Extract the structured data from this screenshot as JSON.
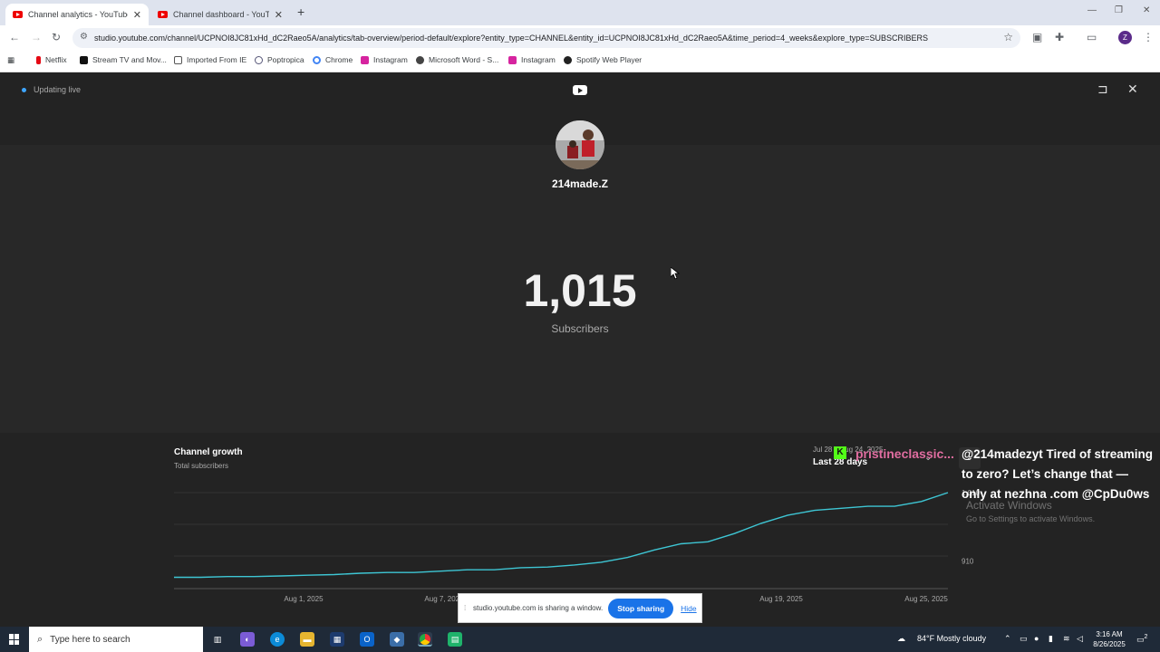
{
  "browser": {
    "tabs": [
      {
        "title": "Channel analytics - YouTube St",
        "active": true
      },
      {
        "title": "Channel dashboard - YouTube",
        "active": false
      }
    ],
    "new_tab": "+",
    "url": "studio.youtube.com/channel/UCPNOI8JC81xHd_dC2Raeo5A/analytics/tab-overview/period-default/explore?entity_type=CHANNEL&entity_id=UCPNOI8JC81xHd_dC2Raeo5A&time_period=4_weeks&explore_type=SUBSCRIBERS",
    "profile_initial": "Z",
    "bookmarks": [
      "Netflix",
      "Stream TV and Mov...",
      "Imported From IE",
      "Poptropica",
      "Chrome",
      "Instagram",
      "Microsoft Word - S...",
      "Instagram",
      "Spotify Web Player"
    ]
  },
  "page": {
    "status": "Updating live",
    "channel_name": "214made.Z",
    "subscriber_count": "1,015",
    "subscriber_label": "Subscribers"
  },
  "growth": {
    "title": "Channel growth",
    "subtitle": "Total subscribers",
    "range_dates": "Jul 28 – Aug 24, 2025",
    "range_label": "Last 28 days"
  },
  "chart_data": {
    "type": "line",
    "x_ticks": [
      "Aug 1, 2025",
      "Aug 7, 2025",
      "Aug 13, 2025",
      "Aug 19, 2025",
      "Aug 25, 2025"
    ],
    "y_ticks": [
      1010,
      910
    ],
    "ylim": [
      880,
      1010
    ],
    "series": [
      {
        "values": [
          886,
          886,
          887,
          887,
          888,
          889,
          890,
          892,
          893,
          893,
          895,
          897,
          897,
          900,
          901,
          904,
          908,
          915,
          926,
          935,
          938,
          950,
          965,
          977,
          984,
          987,
          990,
          990,
          997,
          1010
        ]
      }
    ]
  },
  "overlay": {
    "badge": "K",
    "username": "pristineclassic...",
    "message": "@214madezyt Tired of streaming to zero? Let’s change that — only at nezhna .com @CpDu0ws",
    "activate_title": "Activate Windows",
    "activate_sub": "Go to Settings to activate Windows."
  },
  "sharebar": {
    "message": "studio.youtube.com is sharing a window.",
    "stop": "Stop sharing",
    "hide": "Hide"
  },
  "taskbar": {
    "search_placeholder": "Type here to search",
    "weather": "84°F  Mostly cloudy",
    "time": "3:16 AM",
    "date": "8/26/2025",
    "notifications": "2"
  },
  "colors": {
    "line": "#3ec6d4",
    "accent": "#1a73e8"
  }
}
